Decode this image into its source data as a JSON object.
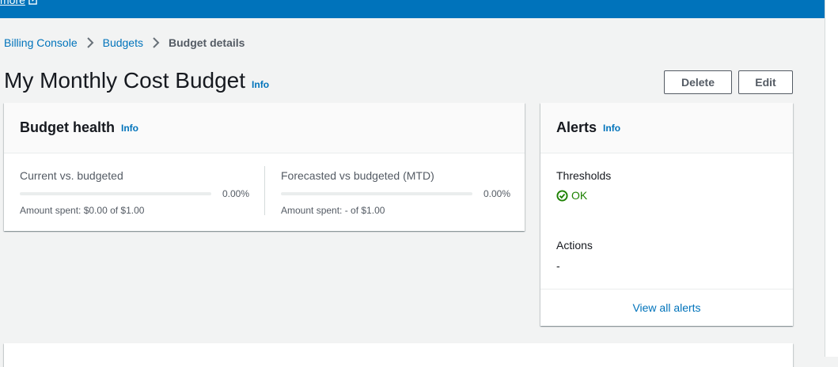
{
  "topbar": {
    "link_label": "more"
  },
  "breadcrumb": {
    "items": [
      "Billing Console",
      "Budgets"
    ],
    "current": "Budget details"
  },
  "page": {
    "title": "My Monthly Cost Budget",
    "info_label": "Info",
    "delete_label": "Delete",
    "edit_label": "Edit"
  },
  "budget_health": {
    "title": "Budget health",
    "info_label": "Info",
    "metrics": [
      {
        "label": "Current vs. budgeted",
        "percent": "0.00%",
        "progress": 0,
        "sub": "Amount spent: $0.00 of $1.00"
      },
      {
        "label": "Forecasted vs budgeted (MTD)",
        "percent": "0.00%",
        "progress": 0,
        "sub": "Amount spent: - of $1.00"
      }
    ]
  },
  "alerts": {
    "title": "Alerts",
    "info_label": "Info",
    "thresholds_label": "Thresholds",
    "thresholds_status": "OK",
    "actions_label": "Actions",
    "actions_value": "-",
    "view_all_label": "View all alerts"
  },
  "colors": {
    "accent": "#0073bb",
    "success": "#1d8102",
    "background": "#f2f3f3"
  }
}
